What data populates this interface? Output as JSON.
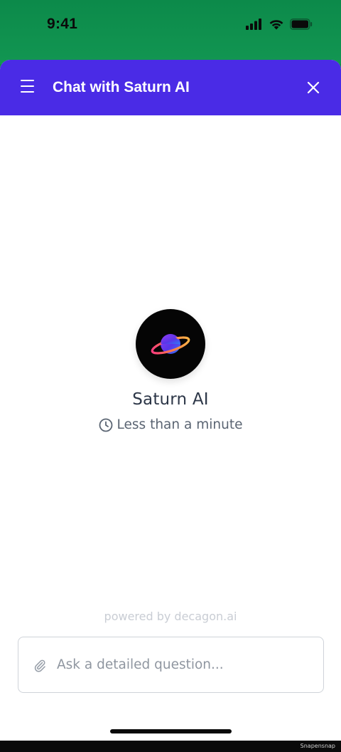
{
  "status_bar": {
    "time": "9:41",
    "icons": [
      "signal-icon",
      "wifi-icon",
      "battery-icon"
    ]
  },
  "header": {
    "title": "Chat with Saturn AI",
    "menu_icon": "hamburger-menu-icon",
    "close_icon": "close-icon",
    "background": "#4a2be6"
  },
  "agent": {
    "name": "Saturn AI",
    "response_time": "Less than a minute",
    "avatar_icon": "saturn-planet-icon"
  },
  "footer": {
    "powered_by": "powered by decagon.ai"
  },
  "composer": {
    "placeholder": "Ask a detailed question...",
    "value": "",
    "attach_icon": "paperclip-icon"
  },
  "watermark": "Snapensnap",
  "colors": {
    "status_bar_green": "#0f8a4c",
    "accent": "#4a2be6",
    "text_dark": "#2d3748",
    "text_muted": "#5a6472"
  }
}
